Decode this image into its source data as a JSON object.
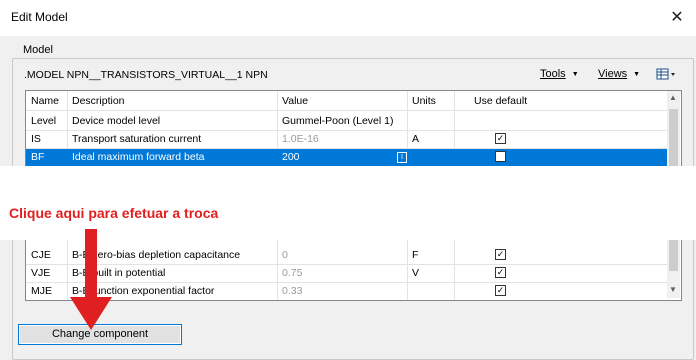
{
  "window": {
    "title": "Edit Model",
    "close": "✕"
  },
  "group": {
    "label": "Model"
  },
  "model_line": ".MODEL NPN__TRANSISTORS_VIRTUAL__1 NPN",
  "menus": {
    "tools": "Tools",
    "views": "Views"
  },
  "table": {
    "headers": {
      "name": "Name",
      "description": "Description",
      "value": "Value",
      "units": "Units",
      "use_default": "Use default"
    },
    "rows": [
      {
        "name": "Level",
        "description": "Device model level",
        "value": "Gummel-Poon (Level 1)",
        "units": "",
        "checked": null
      },
      {
        "name": "IS",
        "description": "Transport saturation current",
        "value": "1.0E-16",
        "units": "A",
        "checked": true
      },
      {
        "name": "BF",
        "description": "Ideal maximum forward beta",
        "value": "200",
        "units": "",
        "checked": false
      },
      {
        "name": "CJE",
        "description": "B-E zero-bias depletion capacitance",
        "value": "0",
        "units": "F",
        "checked": true
      },
      {
        "name": "VJE",
        "description": "B-E built in potential",
        "value": "0.75",
        "units": "V",
        "checked": true
      },
      {
        "name": "MJE",
        "description": "B-E junction exponential factor",
        "value": "0.33",
        "units": "",
        "checked": true
      }
    ]
  },
  "annotation": "Clique aqui para efetuar a troca",
  "button": {
    "change_component": "Change component"
  },
  "colors": {
    "selection": "#0078d7",
    "annotation": "#e02020"
  }
}
